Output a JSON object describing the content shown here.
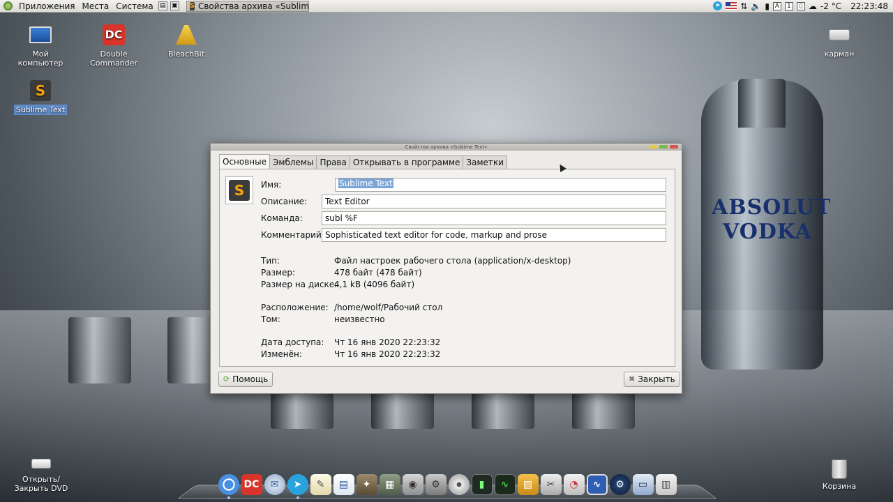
{
  "top_panel": {
    "menu": [
      "Приложения",
      "Места",
      "Система"
    ],
    "task_title": "Свойства архива «Sublim...",
    "tray": {
      "temperature": "-2 °C",
      "clock": "22:23:48",
      "keyboard_box": "1"
    }
  },
  "desktop_icons": {
    "my_computer": "Мой компьютер",
    "double_commander": "Double Commander",
    "bleachbit": "BleachBit",
    "sublime_text": "Sublime Text",
    "pocket": "карман",
    "dvd": "Открыть/ Закрыть DVD",
    "trash": "Корзина"
  },
  "wallpaper": {
    "bottle_line1": "ABSOLUT",
    "bottle_line2": "VODKA"
  },
  "dialog": {
    "title": "Свойства архива «Sublime Text»",
    "tabs": [
      "Основные",
      "Эмблемы",
      "Права",
      "Открывать в программе",
      "Заметки"
    ],
    "active_tab": "Основные",
    "fields": {
      "name_label": "Имя:",
      "name_value": "Sublime Text",
      "description_label": "Описание:",
      "description_value": "Text Editor",
      "command_label": "Команда:",
      "command_value": "subl %F",
      "comment_label": "Комментарий:",
      "comment_value": "Sophisticated text editor for code, markup and prose"
    },
    "info": [
      {
        "label": "Тип:",
        "value": "Файл настроек рабочего стола (application/x-desktop)"
      },
      {
        "label": "Размер:",
        "value": "478 байт (478 байт)"
      },
      {
        "label": "Размер на диске:",
        "value": "4,1 kB (4096 байт)"
      },
      {
        "label": "Расположение:",
        "value": "/home/wolf/Рабочий стол"
      },
      {
        "label": "Том:",
        "value": "неизвестно"
      },
      {
        "label": "Дата доступа:",
        "value": "Чт 16 янв 2020 22:23:32"
      },
      {
        "label": "Изменён:",
        "value": "Чт 16 янв 2020 22:23:32"
      }
    ],
    "help_button": "Помощь",
    "close_button": "Закрыть"
  },
  "dock": {
    "items": [
      "chromium-icon",
      "double-commander-icon",
      "mail-icon",
      "telegram-icon",
      "text-editor-icon",
      "document-icon",
      "gimp-icon",
      "calculator-icon",
      "screenshot-icon",
      "media-tool-icon",
      "disc-icon",
      "terminal-icon",
      "system-monitor-icon",
      "package-icon",
      "tools-icon",
      "disk-usage-icon",
      "monitor-app-icon",
      "steam-icon",
      "remote-desktop-icon",
      "file-cabinet-icon"
    ]
  },
  "colors": {
    "selection": "#7ca6d8",
    "dialog_bg": "#edebe8",
    "sublime_orange": "#f7a50e"
  }
}
